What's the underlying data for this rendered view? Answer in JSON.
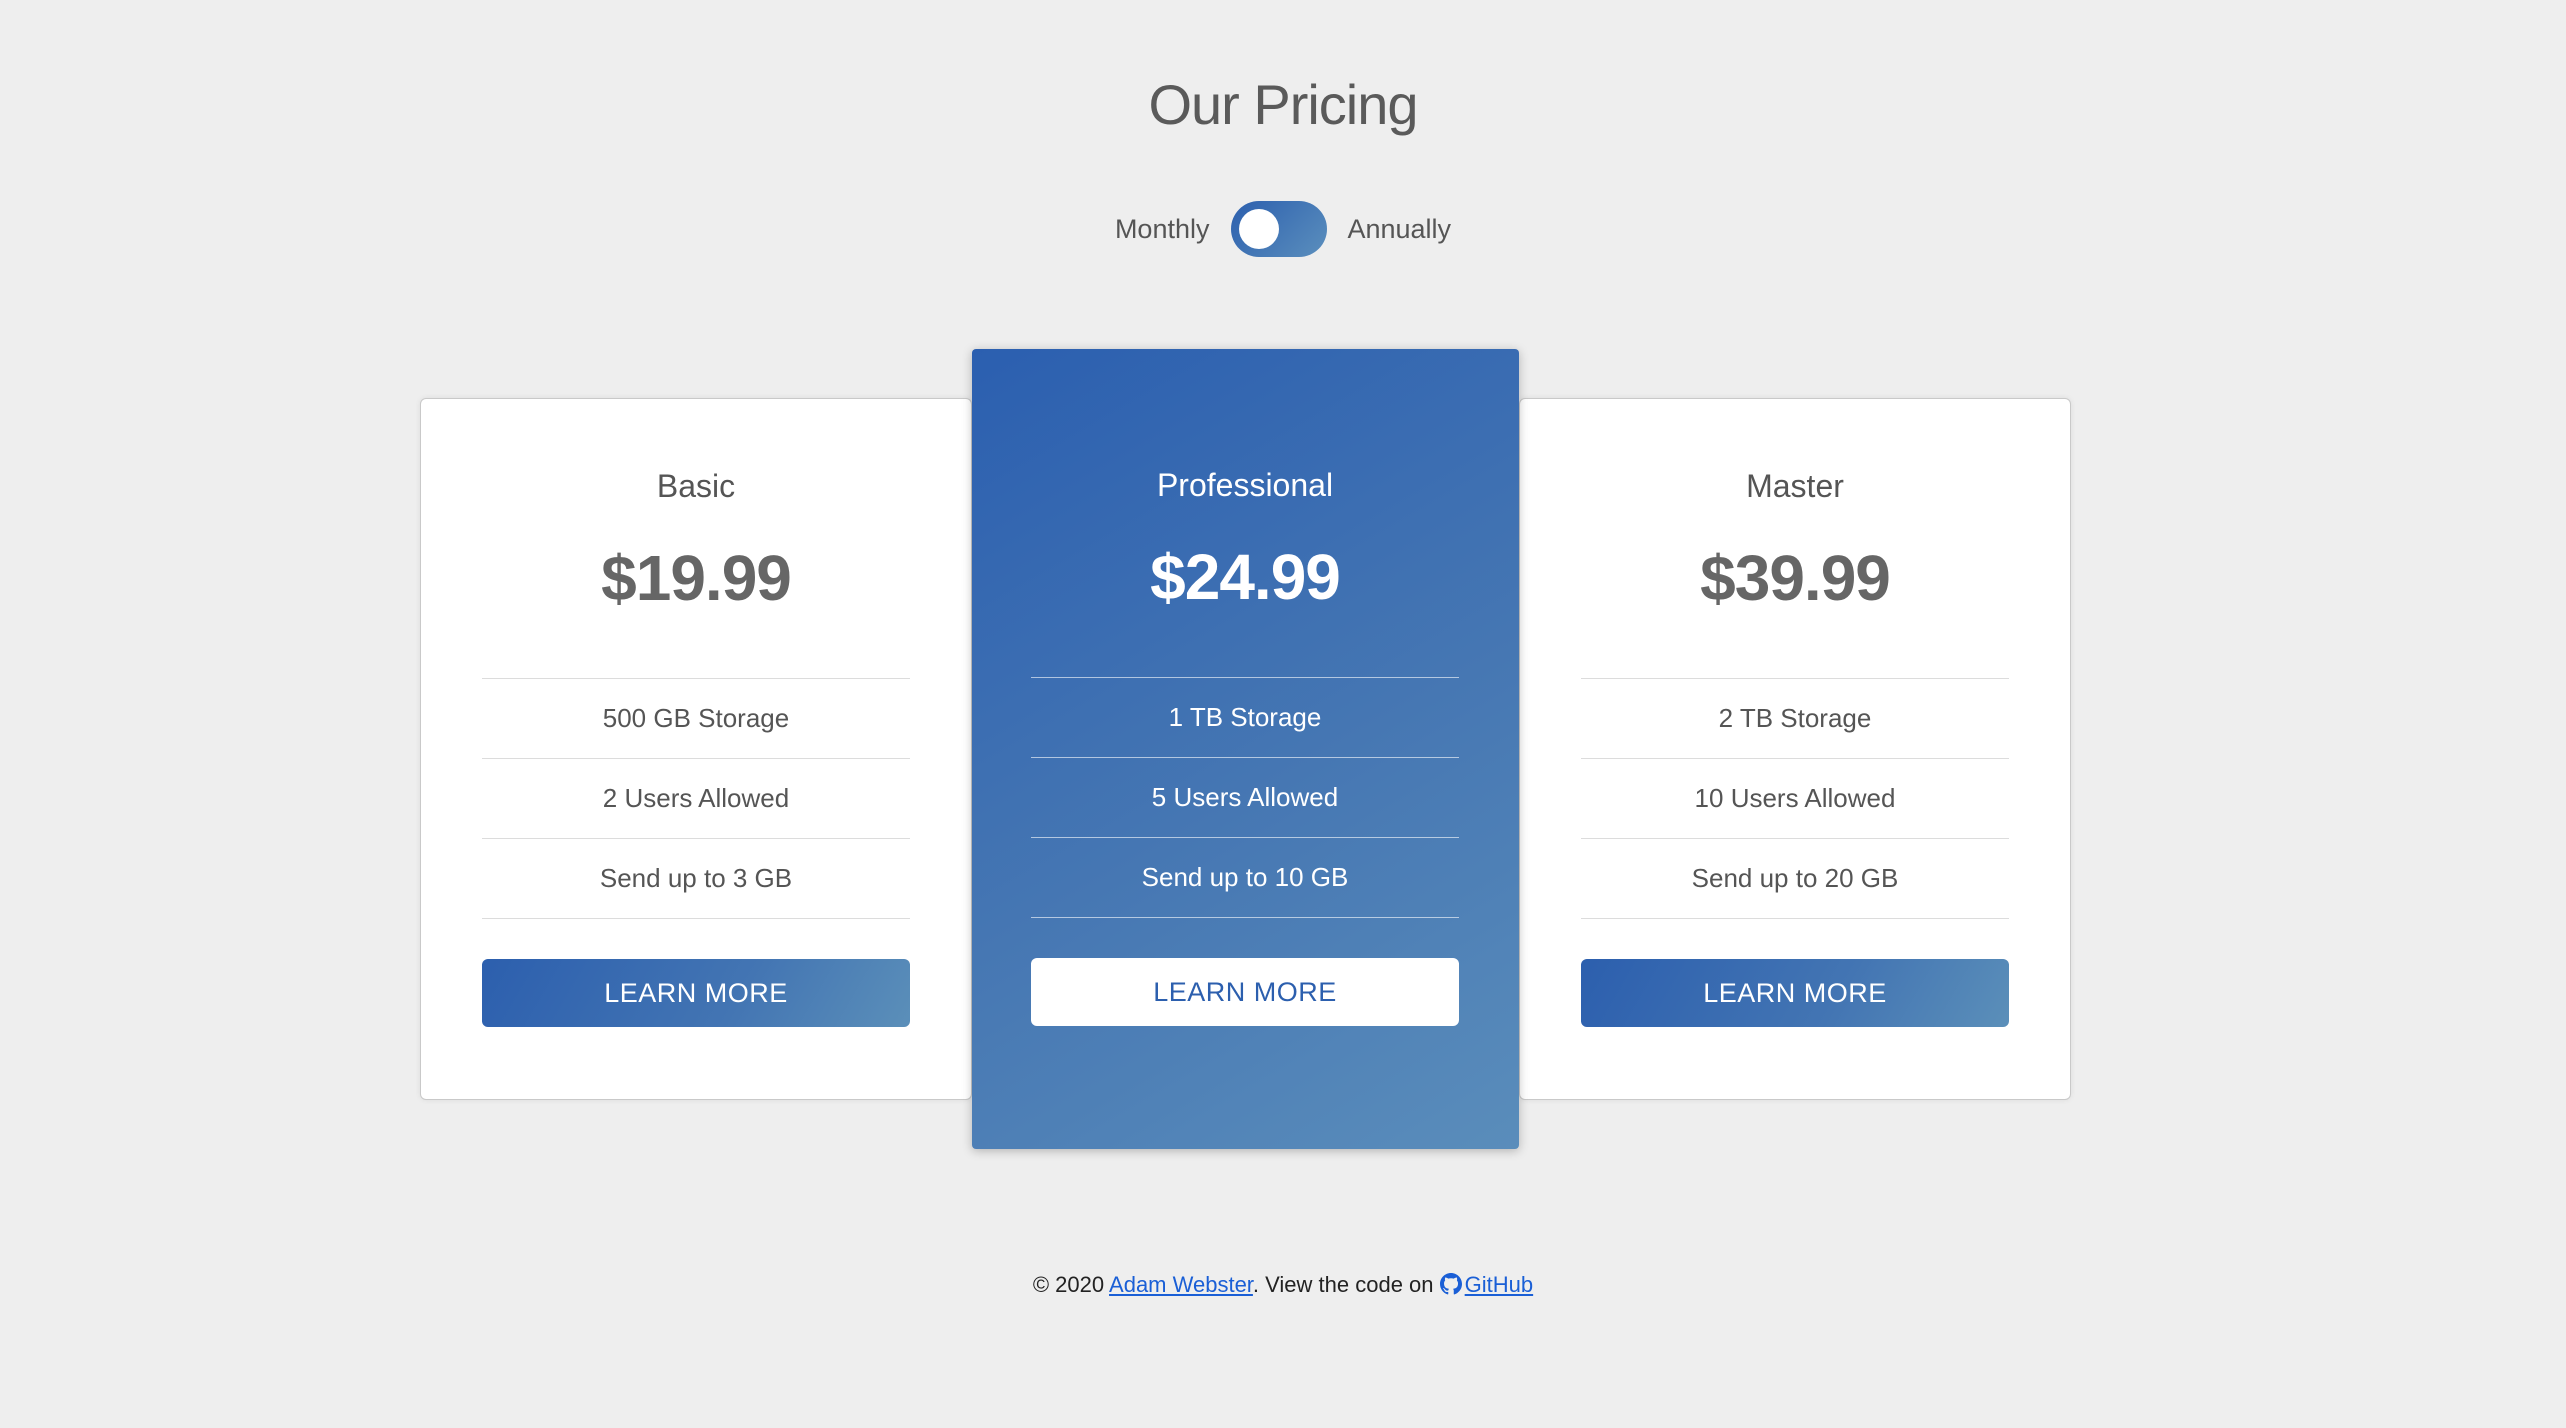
{
  "header": {
    "title": "Our Pricing"
  },
  "billing_toggle": {
    "left_label": "Monthly",
    "right_label": "Annually",
    "selected": "Monthly"
  },
  "plans": [
    {
      "name": "Basic",
      "price": "$19.99",
      "features": [
        "500 GB Storage",
        "2 Users Allowed",
        "Send up to 3 GB"
      ],
      "button_label": "LEARN MORE"
    },
    {
      "name": "Professional",
      "price": "$24.99",
      "features": [
        "1 TB Storage",
        "5 Users Allowed",
        "Send up to 10 GB"
      ],
      "button_label": "LEARN MORE"
    },
    {
      "name": "Master",
      "price": "$39.99",
      "features": [
        "2 TB Storage",
        "10 Users Allowed",
        "Send up to 20 GB"
      ],
      "button_label": "LEARN MORE"
    }
  ],
  "footer": {
    "copyright": "© 2020",
    "author_link": "Adam Webster",
    "mid_text": ". View the code on",
    "github_link": "GitHub",
    "github_icon": "github-icon"
  },
  "colors": {
    "background": "#eeeeee",
    "accent_start": "#2c5fae",
    "accent_end": "#5b8fbd",
    "link": "#1a5fd6"
  }
}
